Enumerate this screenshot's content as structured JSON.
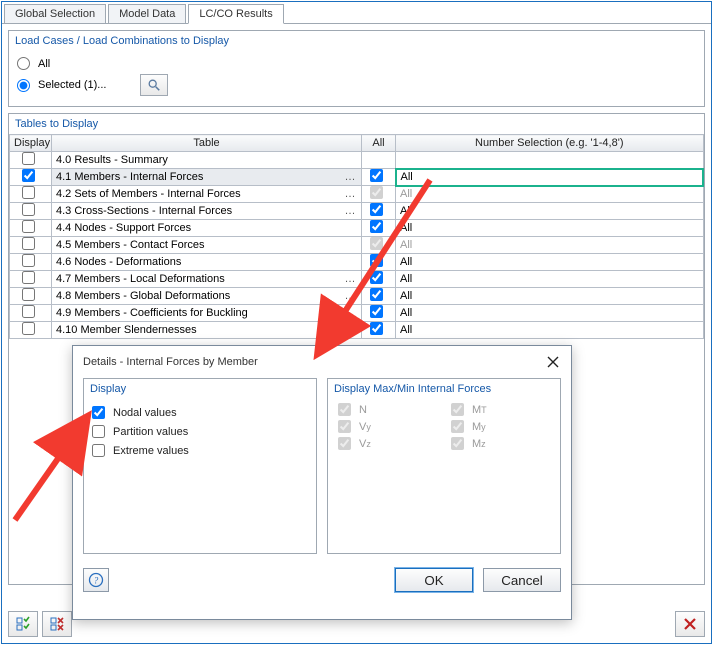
{
  "tabs": [
    "Global Selection",
    "Model Data",
    "LC/CO Results"
  ],
  "active_tab": 2,
  "load_cases": {
    "title": "Load Cases / Load Combinations to Display",
    "opt_all": "All",
    "opt_selected": "Selected (1)..."
  },
  "tables": {
    "title": "Tables to Display",
    "cols": {
      "display": "Display",
      "table": "Table",
      "all": "All",
      "numsel": "Number Selection (e.g. '1-4,8')"
    },
    "rows": [
      {
        "display": false,
        "label": "4.0 Results - Summary",
        "ell": false,
        "all": null,
        "ns": ""
      },
      {
        "display": true,
        "label": "4.1 Members - Internal Forces",
        "ell": true,
        "all": true,
        "ns": "All",
        "hl": true
      },
      {
        "display": false,
        "label": "4.2 Sets of Members - Internal Forces",
        "ell": true,
        "all": true,
        "ns": "All",
        "disabled": true
      },
      {
        "display": false,
        "label": "4.3 Cross-Sections - Internal Forces",
        "ell": true,
        "all": true,
        "ns": "All"
      },
      {
        "display": false,
        "label": "4.4 Nodes - Support Forces",
        "ell": false,
        "all": true,
        "ns": "All"
      },
      {
        "display": false,
        "label": "4.5 Members - Contact Forces",
        "ell": false,
        "all": true,
        "ns": "All",
        "disabled": true
      },
      {
        "display": false,
        "label": "4.6 Nodes - Deformations",
        "ell": false,
        "all": true,
        "ns": "All"
      },
      {
        "display": false,
        "label": "4.7 Members - Local Deformations",
        "ell": true,
        "all": true,
        "ns": "All"
      },
      {
        "display": false,
        "label": "4.8 Members - Global Deformations",
        "ell": true,
        "all": true,
        "ns": "All"
      },
      {
        "display": false,
        "label": "4.9 Members - Coefficients for Buckling",
        "ell": false,
        "all": true,
        "ns": "All"
      },
      {
        "display": false,
        "label": "4.10 Member Slendernesses",
        "ell": false,
        "all": true,
        "ns": "All"
      }
    ]
  },
  "dialog": {
    "title": "Details - Internal Forces by Member",
    "grp_display": "Display",
    "opts": [
      {
        "label": "Nodal values",
        "checked": true
      },
      {
        "label": "Partition values",
        "checked": false
      },
      {
        "label": "Extreme values",
        "checked": false
      }
    ],
    "grp_forces": "Display Max/Min Internal Forces",
    "forces": [
      {
        "l": "N",
        "r": "M",
        "rsub": "T"
      },
      {
        "l": "V",
        "lsub": "y",
        "r": "M",
        "rsub": "y"
      },
      {
        "l": "V",
        "lsub": "z",
        "r": "M",
        "rsub": "z"
      }
    ],
    "ok": "OK",
    "cancel": "Cancel"
  }
}
